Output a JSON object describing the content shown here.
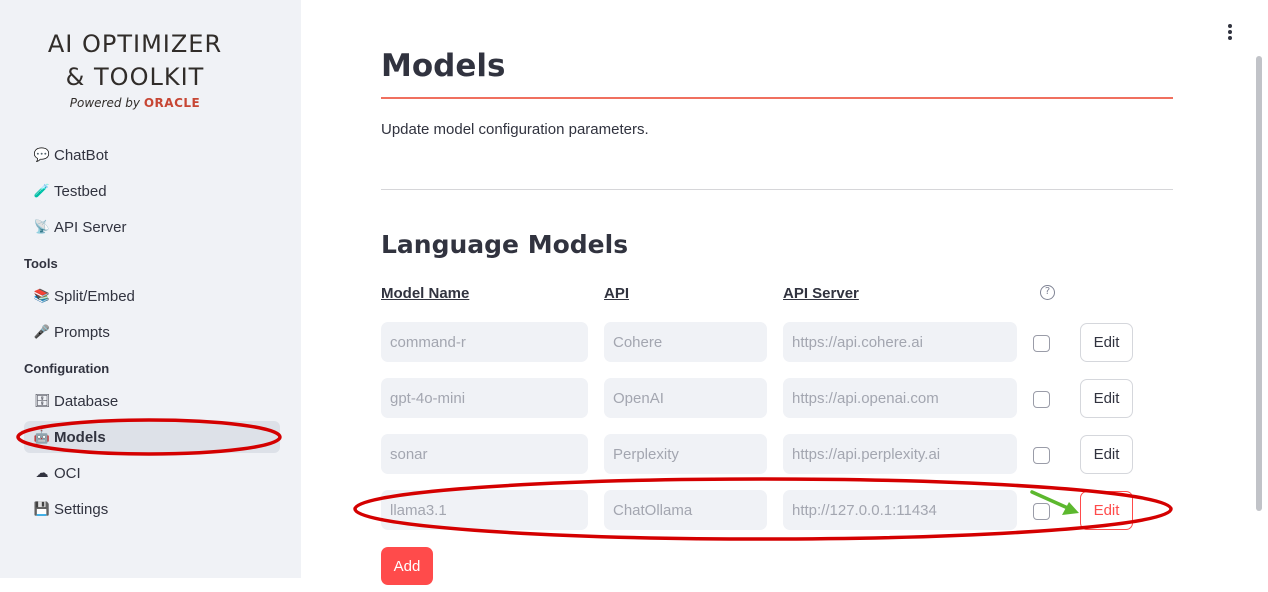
{
  "logo": {
    "line1": "AI OPTIMIZER",
    "line2": "& TOOLKIT",
    "powered_by": "Powered by",
    "brand": "ORACLE"
  },
  "sidebar": {
    "items": [
      {
        "icon": "speech-bubble-icon",
        "glyph": "💬",
        "label": "ChatBot"
      },
      {
        "icon": "test-tube-icon",
        "glyph": "🧪",
        "label": "Testbed"
      },
      {
        "icon": "satellite-antenna-icon",
        "glyph": "📡",
        "label": "API Server"
      }
    ],
    "tools_label": "Tools",
    "tools": [
      {
        "icon": "books-icon",
        "glyph": "📚",
        "label": "Split/Embed"
      },
      {
        "icon": "microphone-icon",
        "glyph": "🎤",
        "label": "Prompts"
      }
    ],
    "config_label": "Configuration",
    "config": [
      {
        "icon": "file-cabinet-icon",
        "glyph": "🗄",
        "label": "Database"
      },
      {
        "icon": "robot-icon",
        "glyph": "🤖",
        "label": "Models",
        "active": true
      },
      {
        "icon": "cloud-icon",
        "glyph": "☁",
        "label": "OCI"
      },
      {
        "icon": "floppy-disk-icon",
        "glyph": "💾",
        "label": "Settings"
      }
    ]
  },
  "main": {
    "title": "Models",
    "subtitle": "Update model configuration parameters.",
    "section_title": "Language Models",
    "columns": {
      "name": "Model Name",
      "api": "API",
      "server": "API Server"
    },
    "help_glyph": "?",
    "rows": [
      {
        "name": "command-r",
        "api": "Cohere",
        "server": "https://api.cohere.ai",
        "edit": "Edit"
      },
      {
        "name": "gpt-4o-mini",
        "api": "OpenAI",
        "server": "https://api.openai.com",
        "edit": "Edit"
      },
      {
        "name": "sonar",
        "api": "Perplexity",
        "server": "https://api.perplexity.ai",
        "edit": "Edit"
      },
      {
        "name": "llama3.1",
        "api": "ChatOllama",
        "server": "http://127.0.0.1:11434",
        "edit": "Edit"
      }
    ],
    "add_label": "Add"
  },
  "colors": {
    "accent": "#ff4b4b",
    "highlight_ring": "#d40000",
    "arrow": "#5cb82e",
    "sidebar_bg": "#f0f2f6"
  }
}
